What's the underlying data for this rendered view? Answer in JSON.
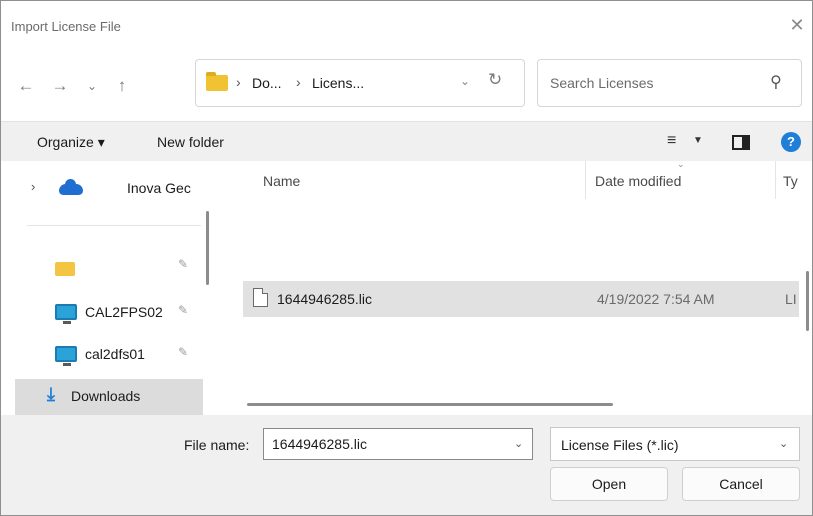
{
  "window": {
    "title": "Import License File"
  },
  "nav": {
    "back_icon": "arrow-left-icon",
    "forward_icon": "arrow-right-icon",
    "recent_icon": "chevron-down-icon",
    "up_icon": "arrow-up-icon",
    "breadcrumb": [
      "Do...",
      "Licens..."
    ],
    "refresh_icon": "refresh-icon",
    "search_placeholder": "Search Licenses"
  },
  "commands": {
    "organize": "Organize ▾",
    "new_folder": "New folder"
  },
  "sidebar": {
    "items": [
      {
        "label": "Inova Gec",
        "icon": "onedrive-cloud-icon",
        "pinned": false
      },
      {
        "label": "",
        "icon": "folder-icon",
        "pinned": true
      },
      {
        "label": "CAL2FPS02",
        "icon": "network-drive-icon",
        "pinned": true
      },
      {
        "label": "cal2dfs01",
        "icon": "network-drive-icon",
        "pinned": true
      },
      {
        "label": "Downloads",
        "icon": "download-arrow-icon",
        "pinned": false,
        "selected": true
      }
    ]
  },
  "files": {
    "columns": [
      "Name",
      "Date modified",
      "Ty"
    ],
    "rows": [
      {
        "name": "1644946285.lic",
        "date": "4/19/2022 7:54 AM",
        "type": "LI"
      }
    ]
  },
  "footer": {
    "file_name_label": "File name:",
    "file_name_value": "1644946285.lic",
    "file_type": "License Files (*.lic)",
    "open_label": "Open",
    "cancel_label": "Cancel"
  },
  "colors": {
    "accent": "#1f7ed6",
    "selection": "#e1e1e1",
    "folder": "#f1c232"
  }
}
